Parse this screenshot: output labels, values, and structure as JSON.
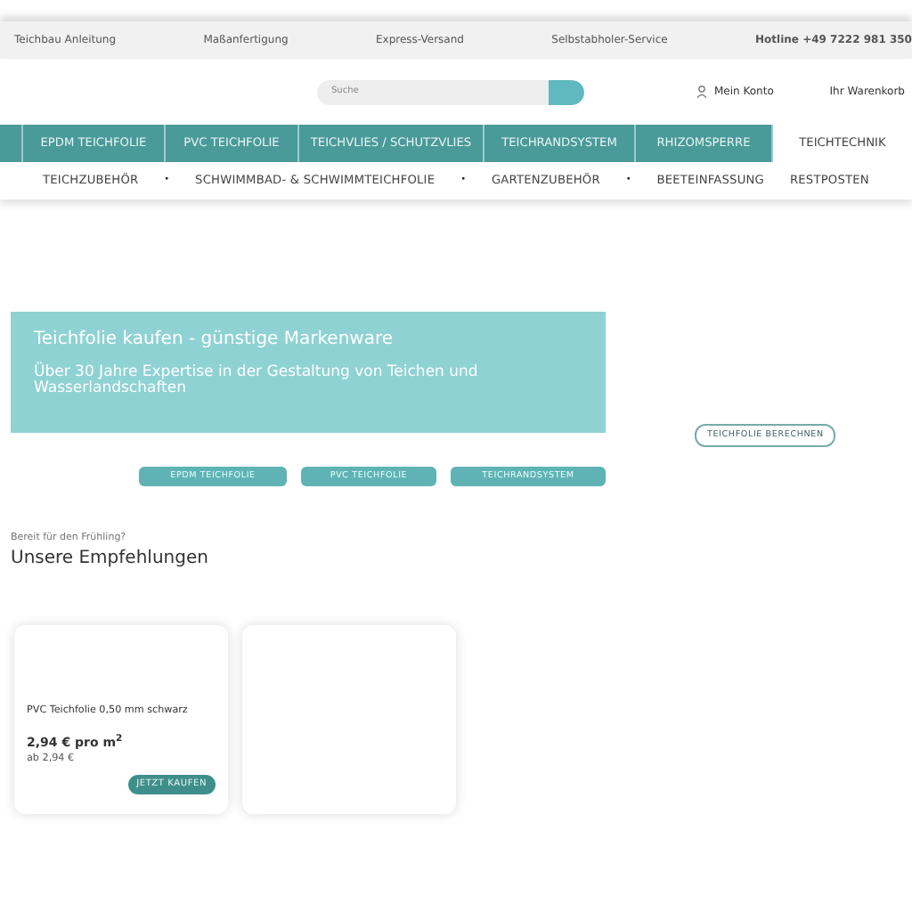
{
  "top_bar": {
    "links": [
      "Teichbau Anleitung",
      "Maßanfertigung",
      "Express-Versand",
      "Selbstabholer-Service"
    ],
    "hotline": "Hotline +49 7222 981 350"
  },
  "header": {
    "search": {
      "placeholder": "Suche"
    },
    "account": "Mein Konto",
    "cart": "Ihr Warenkorb"
  },
  "main_nav": [
    {
      "label": "EPDM TEICHFOLIE",
      "selected": false
    },
    {
      "label": "PVC TEICHFOLIE",
      "selected": false
    },
    {
      "label": "TEICHVLIES / SCHUTZVLIES",
      "selected": false
    },
    {
      "label": "TEICHRANDSYSTEM",
      "selected": false
    },
    {
      "label": "RHIZOMSPERRE",
      "selected": false
    },
    {
      "label": "TEICHTECHNIK",
      "selected": true
    }
  ],
  "sub_nav": [
    {
      "kind": "link",
      "text": "TEICHZUBEHÖR"
    },
    {
      "kind": "bullet",
      "text": "•"
    },
    {
      "kind": "link",
      "text": "SCHWIMMBAD- & SCHWIMMTEICHFOLIE"
    },
    {
      "kind": "bullet",
      "text": "•"
    },
    {
      "kind": "link",
      "text": "GARTENZUBEHÖR"
    },
    {
      "kind": "bullet",
      "text": "•"
    },
    {
      "kind": "link",
      "text": "BEETEINFASSUNG"
    },
    {
      "kind": "link",
      "text": "RESTPOSTEN"
    }
  ],
  "hero": {
    "title": "Teichfolie kaufen - günstige Markenware",
    "subtitle": "Über 30 Jahre Expertise in der Gestaltung von Teichen und Wasserlandschaften",
    "calc_button": "TEICHFOLIE BERECHNEN",
    "category_buttons": [
      "EPDM TEICHFOLIE",
      "PVC TEICHFOLIE",
      "TEICHRANDSYSTEM"
    ]
  },
  "recommendations": {
    "kicker": "Bereit für den Frühling?",
    "title": "Unsere Empfehlungen",
    "products": [
      {
        "name": "PVC Teichfolie 0,50 mm schwarz",
        "price": "2,94 € pro m$^{2}$",
        "from_price": "ab 2,94 €",
        "button": "JETZT KAUFEN",
        "kind": "product"
      },
      {
        "kind": "blank"
      }
    ]
  }
}
